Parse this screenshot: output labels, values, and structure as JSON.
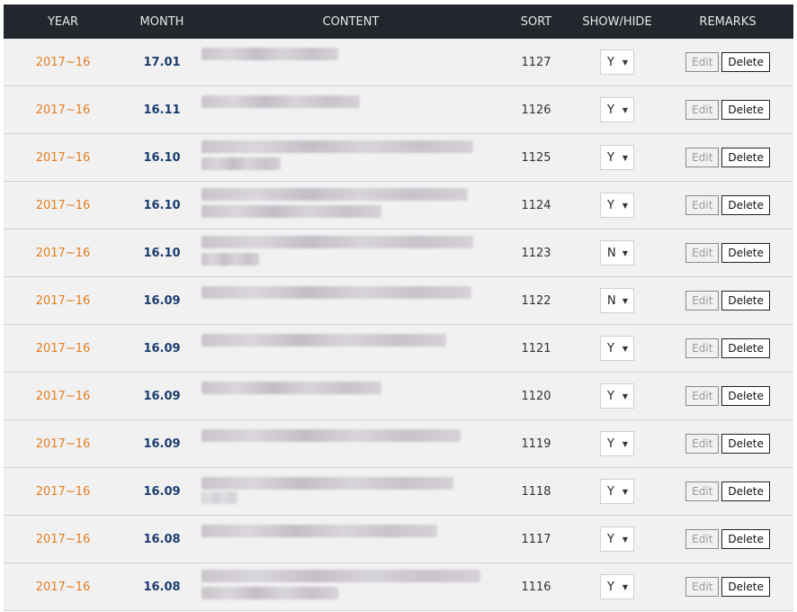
{
  "header": {
    "year": "YEAR",
    "month": "MONTH",
    "content": "CONTENT",
    "sort": "SORT",
    "show_hide": "SHOW/HIDE",
    "remarks": "REMARKS"
  },
  "actions": {
    "edit": "Edit",
    "delete": "Delete"
  },
  "rows": [
    {
      "year": "2017~16",
      "month": "17.01",
      "sort": "1127",
      "show": "Y"
    },
    {
      "year": "2017~16",
      "month": "16.11",
      "sort": "1126",
      "show": "Y"
    },
    {
      "year": "2017~16",
      "month": "16.10",
      "sort": "1125",
      "show": "Y"
    },
    {
      "year": "2017~16",
      "month": "16.10",
      "sort": "1124",
      "show": "Y"
    },
    {
      "year": "2017~16",
      "month": "16.10",
      "sort": "1123",
      "show": "N"
    },
    {
      "year": "2017~16",
      "month": "16.09",
      "sort": "1122",
      "show": "N"
    },
    {
      "year": "2017~16",
      "month": "16.09",
      "sort": "1121",
      "show": "Y"
    },
    {
      "year": "2017~16",
      "month": "16.09",
      "sort": "1120",
      "show": "Y"
    },
    {
      "year": "2017~16",
      "month": "16.09",
      "sort": "1119",
      "show": "Y"
    },
    {
      "year": "2017~16",
      "month": "16.09",
      "sort": "1118",
      "show": "Y"
    },
    {
      "year": "2017~16",
      "month": "16.08",
      "sort": "1117",
      "show": "Y"
    },
    {
      "year": "2017~16",
      "month": "16.08",
      "sort": "1116",
      "show": "Y"
    }
  ]
}
